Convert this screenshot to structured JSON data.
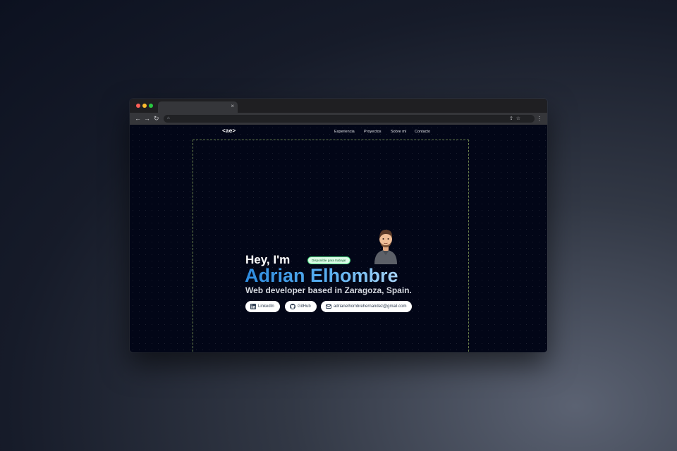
{
  "browser": {
    "tab_close": "×",
    "nav": {
      "back": "←",
      "forward": "→",
      "reload": "↻"
    },
    "omnibox": {
      "lock": "⌂",
      "share": "⇪",
      "star": "☆"
    },
    "menu": "⋮"
  },
  "site": {
    "logo": "<ae>",
    "nav_links": [
      "Experiencia",
      "Proyectos",
      "Sobre mí",
      "Contacto"
    ],
    "hero": {
      "greeting": "Hey, I'm",
      "badge": "Disponible para trabajar",
      "name": "Adrian Elhombre",
      "tagline": "Web developer based in Zaragoza, Spain.",
      "links": [
        {
          "label": "LinkedIn",
          "icon": "linkedin-icon"
        },
        {
          "label": "GitHub",
          "icon": "github-icon"
        },
        {
          "label": "adrianelhombrehernandez@gmail.com",
          "icon": "mail-icon"
        }
      ]
    }
  },
  "colors": {
    "page_bg": "#020617",
    "name_gradient_start": "#2d8be0",
    "name_gradient_end": "#a8d4f6",
    "badge_bg": "#dcfce7",
    "badge_text": "#166534"
  }
}
